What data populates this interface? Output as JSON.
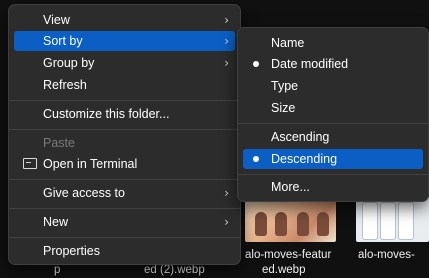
{
  "background_files": {
    "file1_label_line1": "ed (2).webp",
    "file1_label_line0": "p",
    "file2_label_line1": "alo-moves-featur",
    "file2_label_line2": "ed.webp",
    "file3_label_line1": "alo-moves-"
  },
  "context_menu": {
    "items": [
      {
        "label": "View",
        "has_submenu": true
      },
      {
        "label": "Sort by",
        "has_submenu": true,
        "highlighted": true
      },
      {
        "label": "Group by",
        "has_submenu": true
      },
      {
        "label": "Refresh"
      },
      {
        "label": "Customize this folder..."
      },
      {
        "label": "Paste",
        "disabled": true
      },
      {
        "label": "Open in Terminal",
        "icon": "terminal-icon"
      },
      {
        "label": "Give access to",
        "has_submenu": true
      },
      {
        "label": "New",
        "has_submenu": true
      },
      {
        "label": "Properties"
      }
    ]
  },
  "sort_submenu": {
    "items": [
      {
        "label": "Name"
      },
      {
        "label": "Date modified",
        "selected": true
      },
      {
        "label": "Type"
      },
      {
        "label": "Size"
      },
      {
        "label": "Ascending"
      },
      {
        "label": "Descending",
        "selected": true,
        "highlighted": true
      },
      {
        "label": "More..."
      }
    ]
  },
  "colors": {
    "menu_background": "#2c2c2c",
    "highlight": "#0a5ec4",
    "separator": "#414141"
  },
  "icons": {
    "submenu_chevron": "chevron-right-icon",
    "radio_selected": "bullet-dot-icon"
  }
}
